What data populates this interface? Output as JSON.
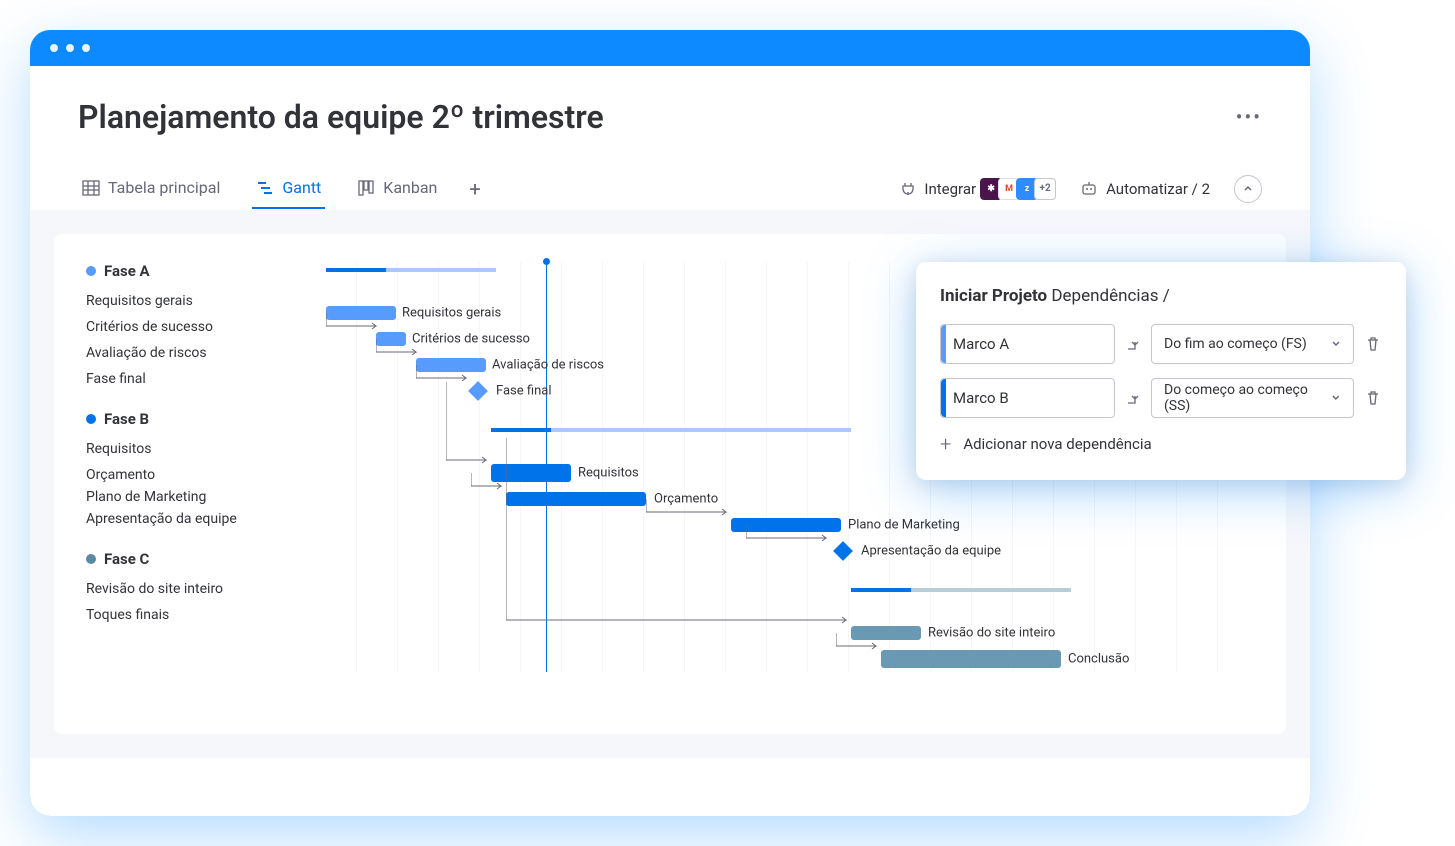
{
  "page": {
    "title": "Planejamento da equipe  2º trimestre"
  },
  "tabs": {
    "main_table": "Tabela principal",
    "gantt": "Gantt",
    "kanban": "Kanban"
  },
  "controls": {
    "integrate": "Integrar",
    "integrate_more": "+2",
    "automate": "Automatizar / 2"
  },
  "phases": {
    "a": {
      "name": "Fase A",
      "tasks": [
        "Requisitos gerais",
        "Critérios de sucesso",
        "Avaliação de riscos",
        "Fase final"
      ]
    },
    "b": {
      "name": "Fase B",
      "tasks": [
        "Requisitos",
        "Orçamento",
        "Plano de Marketing",
        "Apresentação da equipe"
      ]
    },
    "c": {
      "name": "Fase C",
      "tasks": [
        "Revisão do site inteiro",
        "Toques finais"
      ]
    }
  },
  "gantt_labels": {
    "req_gerais": "Requisitos gerais",
    "criterios": "Critérios de sucesso",
    "avaliacao": "Avaliação de riscos",
    "fase_final": "Fase final",
    "requisitos": "Requisitos",
    "orcamento": "Orçamento",
    "plano": "Plano de Marketing",
    "apresentacao": "Apresentação da equipe",
    "revisao": "Revisão do site inteiro",
    "conclusao": "Conclusão"
  },
  "dependencies": {
    "title_bold": "Iniciar Projeto",
    "title_rest": " Dependências /",
    "rows": [
      {
        "task": "Marco A",
        "type": "Do fim ao começo (FS)"
      },
      {
        "task": "Marco B",
        "type": "Do começo ao começo (SS)"
      }
    ],
    "add": "Adicionar nova dependência"
  }
}
